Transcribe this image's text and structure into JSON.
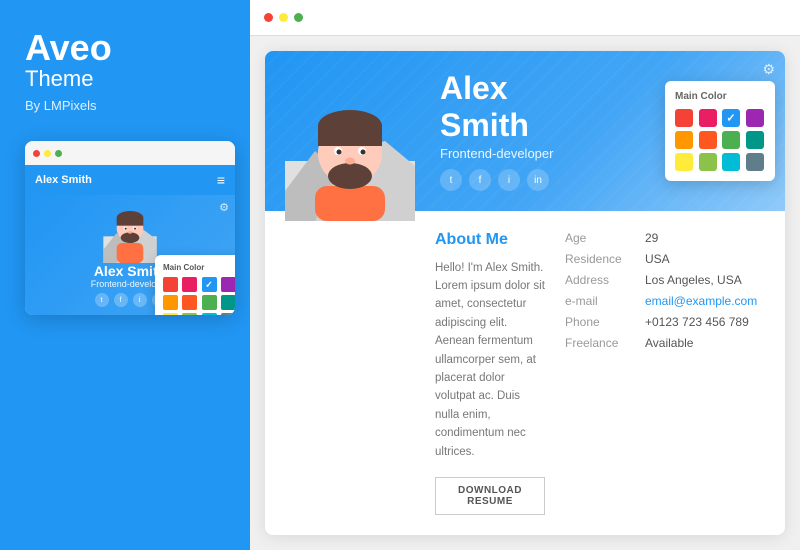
{
  "brand": {
    "title": "Aveo",
    "subtitle": "Theme",
    "by": "By LMPixels"
  },
  "mini_card": {
    "nav_title": "Alex Smith",
    "hero_name": "Alex Smith",
    "hero_role": "Frontend-developer",
    "color_picker_label": "Main Color",
    "colors": [
      {
        "hex": "#f44336",
        "active": false
      },
      {
        "hex": "#e91e63",
        "active": false
      },
      {
        "hex": "#2196F3",
        "active": true
      },
      {
        "hex": "#9c27b0",
        "active": false
      },
      {
        "hex": "#ff9800",
        "active": false
      },
      {
        "hex": "#ff5722",
        "active": false
      },
      {
        "hex": "#4caf50",
        "active": false
      },
      {
        "hex": "#009688",
        "active": false
      },
      {
        "hex": "#ffeb3b",
        "active": false
      },
      {
        "hex": "#8bc34a",
        "active": false
      },
      {
        "hex": "#00bcd4",
        "active": false
      },
      {
        "hex": "#607d8b",
        "active": false
      }
    ]
  },
  "profile": {
    "name": "Alex Smith",
    "role": "Frontend-developer",
    "socials": [
      "t",
      "f",
      "i",
      "in"
    ],
    "about_title_prefix": "About ",
    "about_title_highlight": "Me",
    "about_text": "Hello! I'm Alex Smith. Lorem ipsum dolor sit amet, consectetur adipiscing elit. Aenean fermentum ullamcorper sem, at placerat dolor volutpat ac. Duis nulla enim, condimentum nec ultrices.",
    "download_btn": "DOWNLOAD RESUME",
    "info": [
      {
        "label": "Age",
        "value": "29",
        "link": false
      },
      {
        "label": "Residence",
        "value": "USA",
        "link": false
      },
      {
        "label": "Address",
        "value": "Los Angeles, USA",
        "link": false
      },
      {
        "label": "e-mail",
        "value": "email@example.com",
        "link": true
      },
      {
        "label": "Phone",
        "value": "+0123 723 456 789",
        "link": false
      },
      {
        "label": "Freelance",
        "value": "Available",
        "link": false
      }
    ],
    "color_picker_label": "Main Color",
    "colors": [
      {
        "hex": "#f44336",
        "active": false
      },
      {
        "hex": "#e91e63",
        "active": false
      },
      {
        "hex": "#2196F3",
        "active": true
      },
      {
        "hex": "#9c27b0",
        "active": false
      },
      {
        "hex": "#ff9800",
        "active": false
      },
      {
        "hex": "#ff5722",
        "active": false
      },
      {
        "hex": "#4caf50",
        "active": false
      },
      {
        "hex": "#009688",
        "active": false
      },
      {
        "hex": "#ffeb3b",
        "active": false
      },
      {
        "hex": "#8bc34a",
        "active": false
      },
      {
        "hex": "#00bcd4",
        "active": false
      },
      {
        "hex": "#607d8b",
        "active": false
      }
    ]
  }
}
